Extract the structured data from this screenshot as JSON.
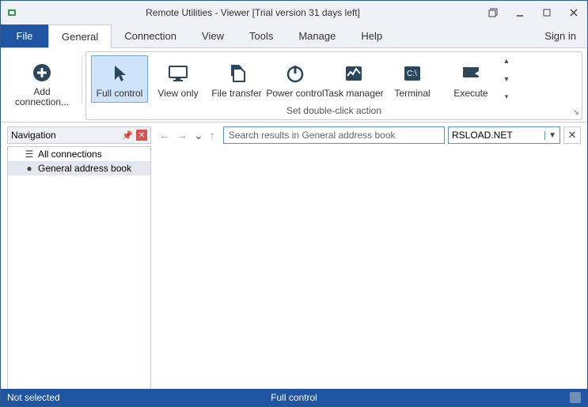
{
  "window": {
    "title": "Remote Utilities - Viewer [Trial version 31 days left]"
  },
  "menu": {
    "file": "File",
    "tabs": [
      "General",
      "Connection",
      "View",
      "Tools",
      "Manage",
      "Help"
    ],
    "active_tab_index": 0,
    "signin": "Sign in"
  },
  "ribbon": {
    "add_connection": "Add\nconnection...",
    "group_caption": "Set double-click action",
    "buttons": [
      {
        "label": "Full control",
        "icon": "cursor-icon",
        "active": true
      },
      {
        "label": "View only",
        "icon": "monitor-icon",
        "active": false
      },
      {
        "label": "File transfer",
        "icon": "files-icon",
        "active": false
      },
      {
        "label": "Power control",
        "icon": "power-icon",
        "active": false
      },
      {
        "label": "Task manager",
        "icon": "activity-icon",
        "active": false
      },
      {
        "label": "Terminal",
        "icon": "terminal-icon",
        "active": false
      },
      {
        "label": "Execute",
        "icon": "execute-icon",
        "active": false
      }
    ]
  },
  "navigation": {
    "panel_title": "Navigation",
    "items": [
      {
        "label": "All connections",
        "icon": "list-icon",
        "selected": false
      },
      {
        "label": "General address book",
        "icon": "bullet-icon",
        "selected": true
      }
    ]
  },
  "search": {
    "placeholder": "Search results in General address book",
    "combo_value": "RSLOAD.NET"
  },
  "status": {
    "left": "Not selected",
    "center": "Full control"
  }
}
